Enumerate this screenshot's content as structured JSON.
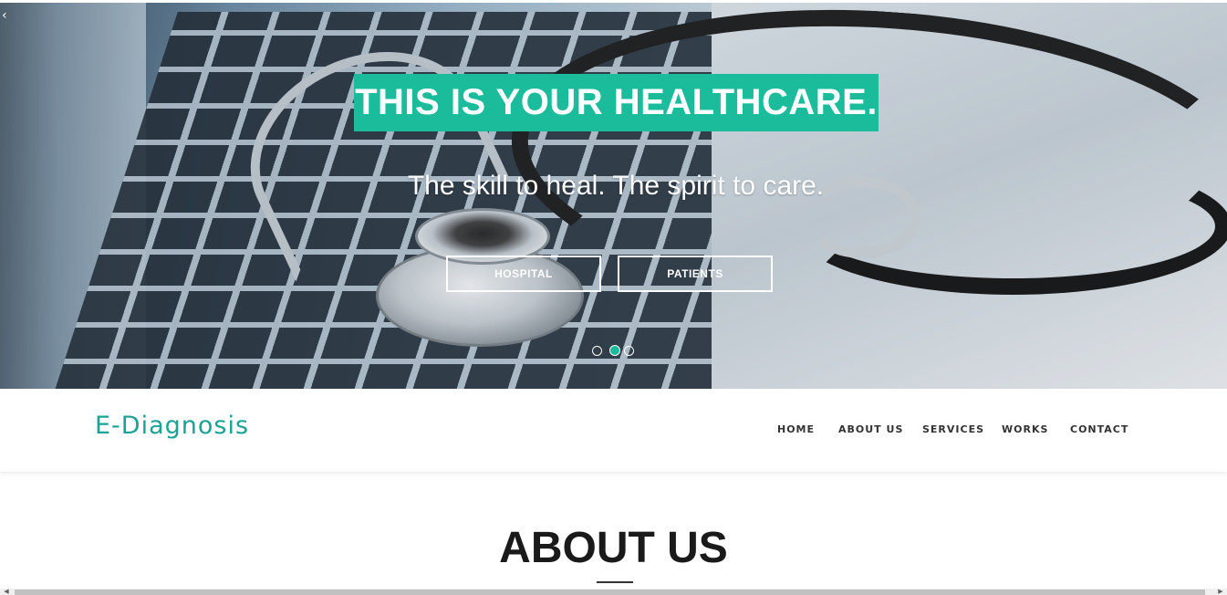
{
  "hero": {
    "title": "THIS IS YOUR HEALTHCARE.",
    "subtitle": "The skill to heal. The spirit to care.",
    "buttons": [
      {
        "label": "HOSPITAL"
      },
      {
        "label": "PATIENTS"
      }
    ],
    "slider_dots": {
      "count": 3,
      "active_index": 1
    },
    "accent_color": "#1abc9c",
    "background_image": "laptop keyboard with stethoscope"
  },
  "navbar": {
    "brand": "E-Diagnosis",
    "brand_color": "#1aa394",
    "links": [
      {
        "label": "HOME"
      },
      {
        "label": "ABOUT US"
      },
      {
        "label": "SERVICES"
      },
      {
        "label": "WORKS"
      },
      {
        "label": "CONTACT"
      }
    ]
  },
  "about": {
    "heading": "ABOUT US"
  },
  "icons": {
    "slider_prev": "chevron-left-icon",
    "scroll_left": "arrow-left-icon",
    "scroll_right": "arrow-right-icon"
  }
}
